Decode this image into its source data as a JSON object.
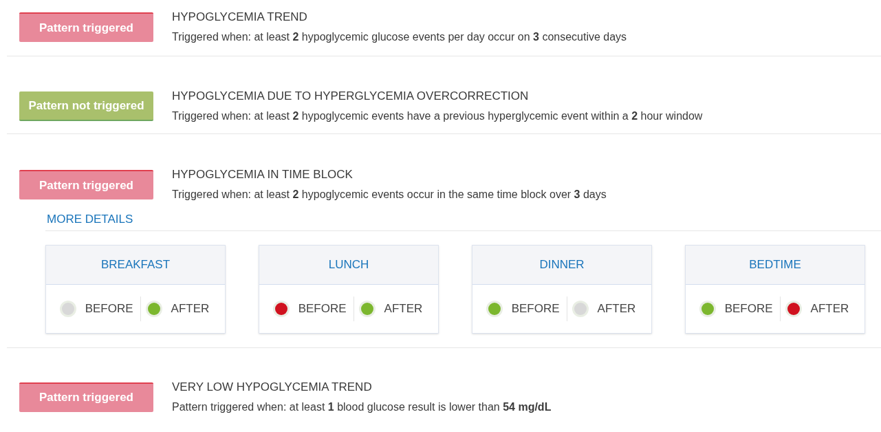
{
  "patterns": [
    {
      "status": "Pattern triggered",
      "triggered": true,
      "title": "HYPOGLYCEMIA TREND",
      "description": "Triggered when: at least **2** hypoglycemic glucose events per day occur on **3** consecutive days"
    },
    {
      "status": "Pattern not triggered",
      "triggered": false,
      "title": "HYPOGLYCEMIA DUE TO HYPERGLYCEMIA OVERCORRECTION",
      "description": "Triggered when: at least **2** hypoglycemic events have a previous hyperglycemic event within a **2** hour window"
    },
    {
      "status": "Pattern triggered",
      "triggered": true,
      "title": "HYPOGLYCEMIA IN TIME BLOCK",
      "description": "Triggered when: at least **2** hypoglycemic events occur in the same time block over **3** days",
      "details": {
        "link": "MORE DETAILS",
        "blocks": [
          {
            "name": "BREAKFAST",
            "slots": [
              {
                "label": "BEFORE",
                "color": "#d8d8d8"
              },
              {
                "label": "AFTER",
                "color": "#7cb72e"
              }
            ]
          },
          {
            "name": "LUNCH",
            "slots": [
              {
                "label": "BEFORE",
                "color": "#d0121f"
              },
              {
                "label": "AFTER",
                "color": "#7cb72e"
              }
            ]
          },
          {
            "name": "DINNER",
            "slots": [
              {
                "label": "BEFORE",
                "color": "#7cb72e"
              },
              {
                "label": "AFTER",
                "color": "#d8d8d8"
              }
            ]
          },
          {
            "name": "BEDTIME",
            "slots": [
              {
                "label": "BEFORE",
                "color": "#7cb72e"
              },
              {
                "label": "AFTER",
                "color": "#d0121f"
              }
            ]
          }
        ]
      }
    },
    {
      "status": "Pattern triggered",
      "triggered": true,
      "title": "VERY LOW HYPOGLYCEMIA TREND",
      "description": "Pattern triggered when: at least **1** blood glucose result is lower than **54 mg/dL**"
    }
  ]
}
